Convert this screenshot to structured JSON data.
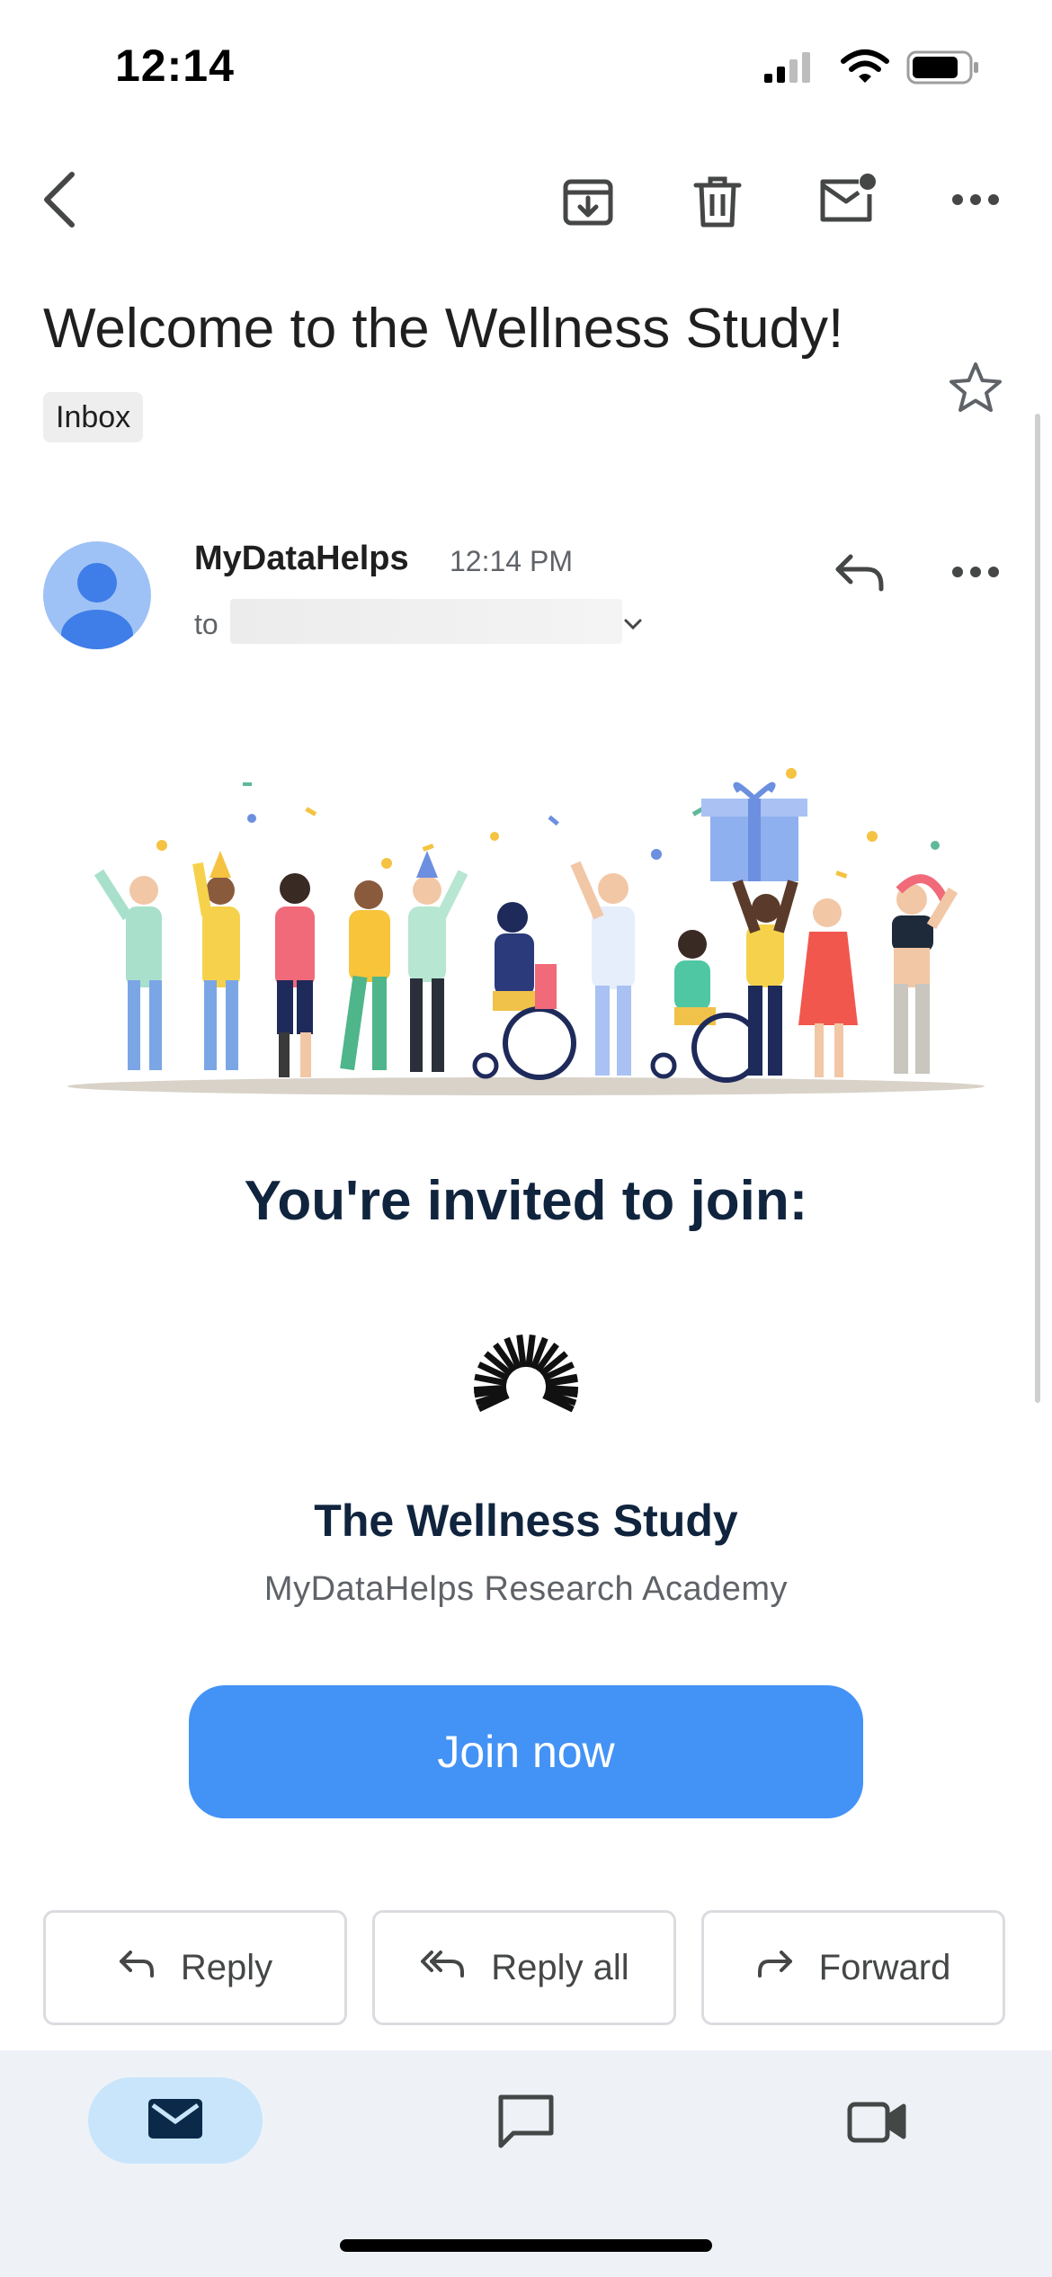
{
  "status_bar": {
    "time": "12:14"
  },
  "toolbar": {
    "back_icon": "chevron-left-icon",
    "archive_icon": "archive-icon",
    "delete_icon": "trash-icon",
    "mark_unread_icon": "mail-unread-icon",
    "more_icon": "more-horizontal-icon"
  },
  "email": {
    "subject": "Welcome to the Wellness Study!",
    "label": "Inbox",
    "sender": "MyDataHelps",
    "time": "12:14 PM",
    "to_label": "to"
  },
  "body": {
    "heading": "You're invited to join:",
    "study_name": "The Wellness Study",
    "organization": "MyDataHelps Research Academy",
    "join_button": "Join now"
  },
  "actions": {
    "reply": "Reply",
    "reply_all": "Reply all",
    "forward": "Forward"
  },
  "bottom_nav": {
    "items": [
      "mail-icon",
      "chat-icon",
      "video-icon"
    ]
  },
  "colors": {
    "accent": "#4392f6",
    "heading": "#10243e",
    "nav_active": "#c8e5fb",
    "nav_bg": "#eef2f7"
  }
}
